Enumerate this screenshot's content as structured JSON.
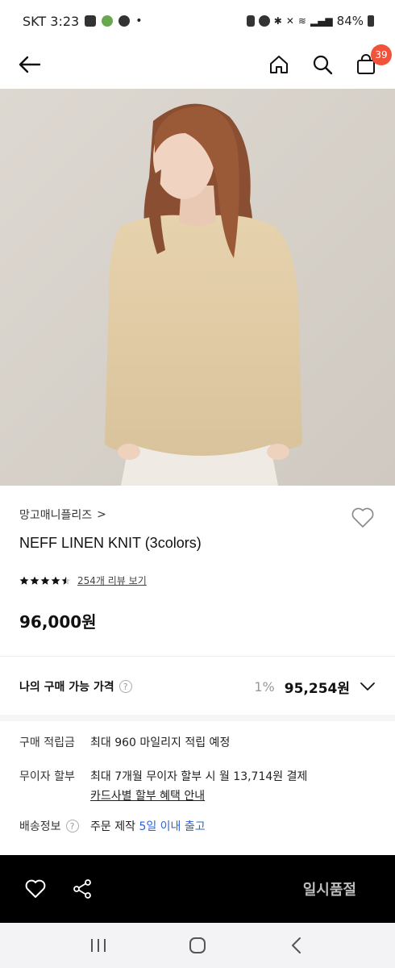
{
  "status_bar": {
    "carrier_time": "SKT 3:23",
    "dot": "•",
    "battery": "84%"
  },
  "header": {
    "cart_count": "39"
  },
  "product": {
    "brand": "망고매니플리즈",
    "brand_chevron": ">",
    "name": "NEFF LINEN KNIT (3colors)",
    "rating_stars": 4.5,
    "review_link": "254개 리뷰 보기",
    "price": "96,000원"
  },
  "purchase_price": {
    "label": "나의 구매 가능 가격",
    "help": "?",
    "discount": "1%",
    "price": "95,254원"
  },
  "info": {
    "points_label": "구매 적립금",
    "points_value": "최대 960 마일리지 적립 예정",
    "installment_label": "무이자 할부",
    "installment_value": "최대 7개월 무이자 할부 시 월 13,714원 결제",
    "installment_link": "카드사별 할부 혜택 안내",
    "shipping_label": "배송정보",
    "shipping_help": "?",
    "shipping_value_prefix": "주문 제작",
    "shipping_value_highlight": "5일 이내 출고"
  },
  "action_bar": {
    "soldout_label": "일시품절"
  },
  "colors": {
    "accent_badge": "#f0533a",
    "highlight_blue": "#2e63d6",
    "action_bar_bg": "#000000"
  }
}
